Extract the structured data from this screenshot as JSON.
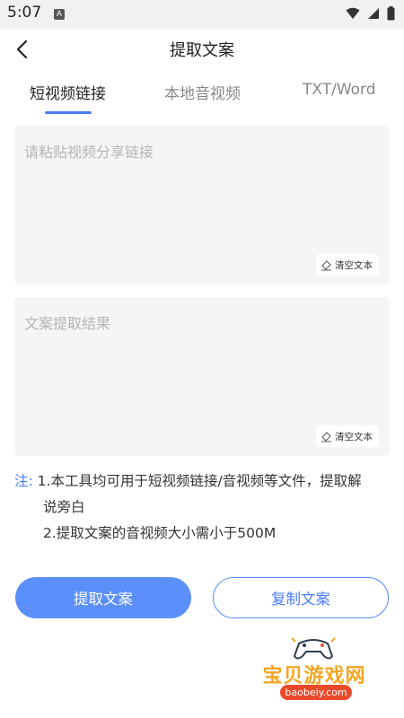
{
  "status_bar": {
    "time": "5:07",
    "notification_badge": "A"
  },
  "app_bar": {
    "title": "提取文案"
  },
  "tabs": [
    {
      "label": "短视频链接",
      "active": true
    },
    {
      "label": "本地音视频",
      "active": false
    },
    {
      "label": "TXT/Word",
      "active": false
    }
  ],
  "input_area": {
    "placeholder": "请粘贴视频分享链接",
    "clear_label": "清空文本"
  },
  "result_area": {
    "placeholder": "文案提取结果",
    "clear_label": "清空文本"
  },
  "notes": {
    "label": "注:",
    "line1a": "1.本工具均可用于短视频链接/音视频等文件，提取解",
    "line1b": "说旁白",
    "line2": "2.提取文案的音视频大小需小于500M"
  },
  "buttons": {
    "extract": "提取文案",
    "copy": "复制文案"
  },
  "watermark": {
    "name": "宝贝游戏网",
    "url": "baobeiy.com"
  },
  "colors": {
    "accent": "#5b8ff9",
    "text_accent": "#4a7cf6",
    "watermark": "#f5a623"
  }
}
